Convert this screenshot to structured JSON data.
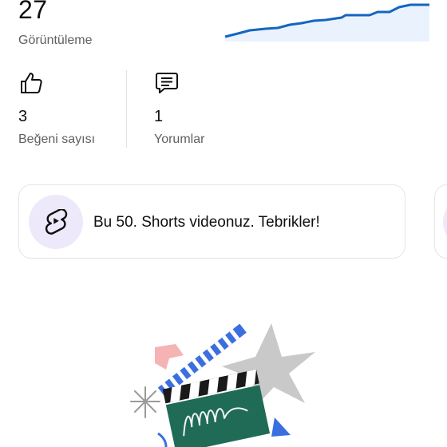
{
  "views": {
    "value": "27",
    "label": "Görüntüleme",
    "trend_color": "#1565c0"
  },
  "likes": {
    "value": "3",
    "label": "Beğeni sayısı",
    "icon": "thumbs-up-icon"
  },
  "comments": {
    "value": "1",
    "label": "Yorumlar",
    "icon": "comment-icon"
  },
  "milestone": {
    "text": "Bu 50. Shorts videonuz. Tebrikler!",
    "icon": "shorts-icon"
  }
}
